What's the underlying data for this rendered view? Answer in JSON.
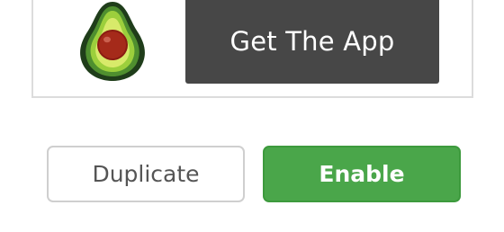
{
  "promo": {
    "cta_label": "Get The App",
    "logo_icon": "avocado-icon",
    "cta_color": "#474747"
  },
  "actions": {
    "duplicate_label": "Duplicate",
    "enable_label": "Enable",
    "enable_color": "#4aa64a"
  }
}
